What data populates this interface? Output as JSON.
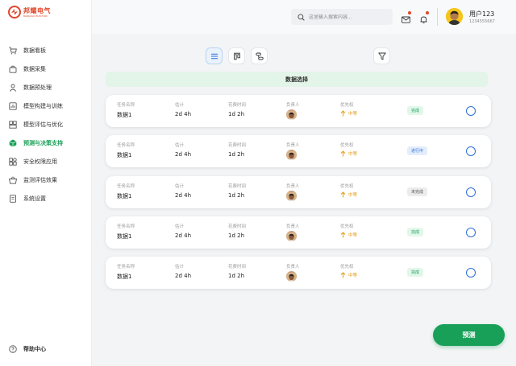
{
  "brand": {
    "name": "邦耀电气",
    "sub": "BANGYAO ELECTRIC",
    "color": "#e0472b"
  },
  "sidebar": {
    "items": [
      {
        "label": "数据看板",
        "icon": "cart-icon",
        "active": false
      },
      {
        "label": "数据采集",
        "icon": "bag-icon",
        "active": false
      },
      {
        "label": "数据预处理",
        "icon": "user-icon",
        "active": false
      },
      {
        "label": "模型构建与训练",
        "icon": "chart-icon",
        "active": false
      },
      {
        "label": "模型评估与优化",
        "icon": "layout-icon",
        "active": false
      },
      {
        "label": "预测与决策支持",
        "icon": "cube-icon",
        "active": true
      },
      {
        "label": "安全权限应用",
        "icon": "shapes-icon",
        "active": false
      },
      {
        "label": "监测评估效果",
        "icon": "basket-icon",
        "active": false
      },
      {
        "label": "系统设置",
        "icon": "document-icon",
        "active": false
      }
    ],
    "help_label": "帮助中心"
  },
  "header": {
    "search_placeholder": "这里输入搜索内容...",
    "user_name": "用户123",
    "user_id": "1234555667"
  },
  "toolbar": {
    "views": [
      "list-view-icon",
      "board-view-icon",
      "flow-view-icon"
    ],
    "filter_icon": "filter-icon"
  },
  "section": {
    "title": "数据选择"
  },
  "columns": {
    "task": "任务名称",
    "estimate": "估计",
    "spent": "花费时间",
    "owner": "负责人",
    "priority": "优先权"
  },
  "tasks": [
    {
      "name": "数据1",
      "estimate": "2d 4h",
      "spent": "1d 2h",
      "priority": "中等",
      "status": "完成",
      "status_type": "done"
    },
    {
      "name": "数据1",
      "estimate": "2d 4h",
      "spent": "1d 2h",
      "priority": "中等",
      "status": "进行中",
      "status_type": "doing"
    },
    {
      "name": "数据1",
      "estimate": "2d 4h",
      "spent": "1d 2h",
      "priority": "中等",
      "status": "未完成",
      "status_type": "todo"
    },
    {
      "name": "数据1",
      "estimate": "2d 4h",
      "spent": "1d 2h",
      "priority": "中等",
      "status": "完成",
      "status_type": "done"
    },
    {
      "name": "数据1",
      "estimate": "2d 4h",
      "spent": "1d 2h",
      "priority": "中等",
      "status": "完成",
      "status_type": "done"
    }
  ],
  "actions": {
    "predict_label": "预测"
  },
  "colors": {
    "accent": "#18a058",
    "link": "#2d6fd6",
    "priority": "#e49b12"
  }
}
